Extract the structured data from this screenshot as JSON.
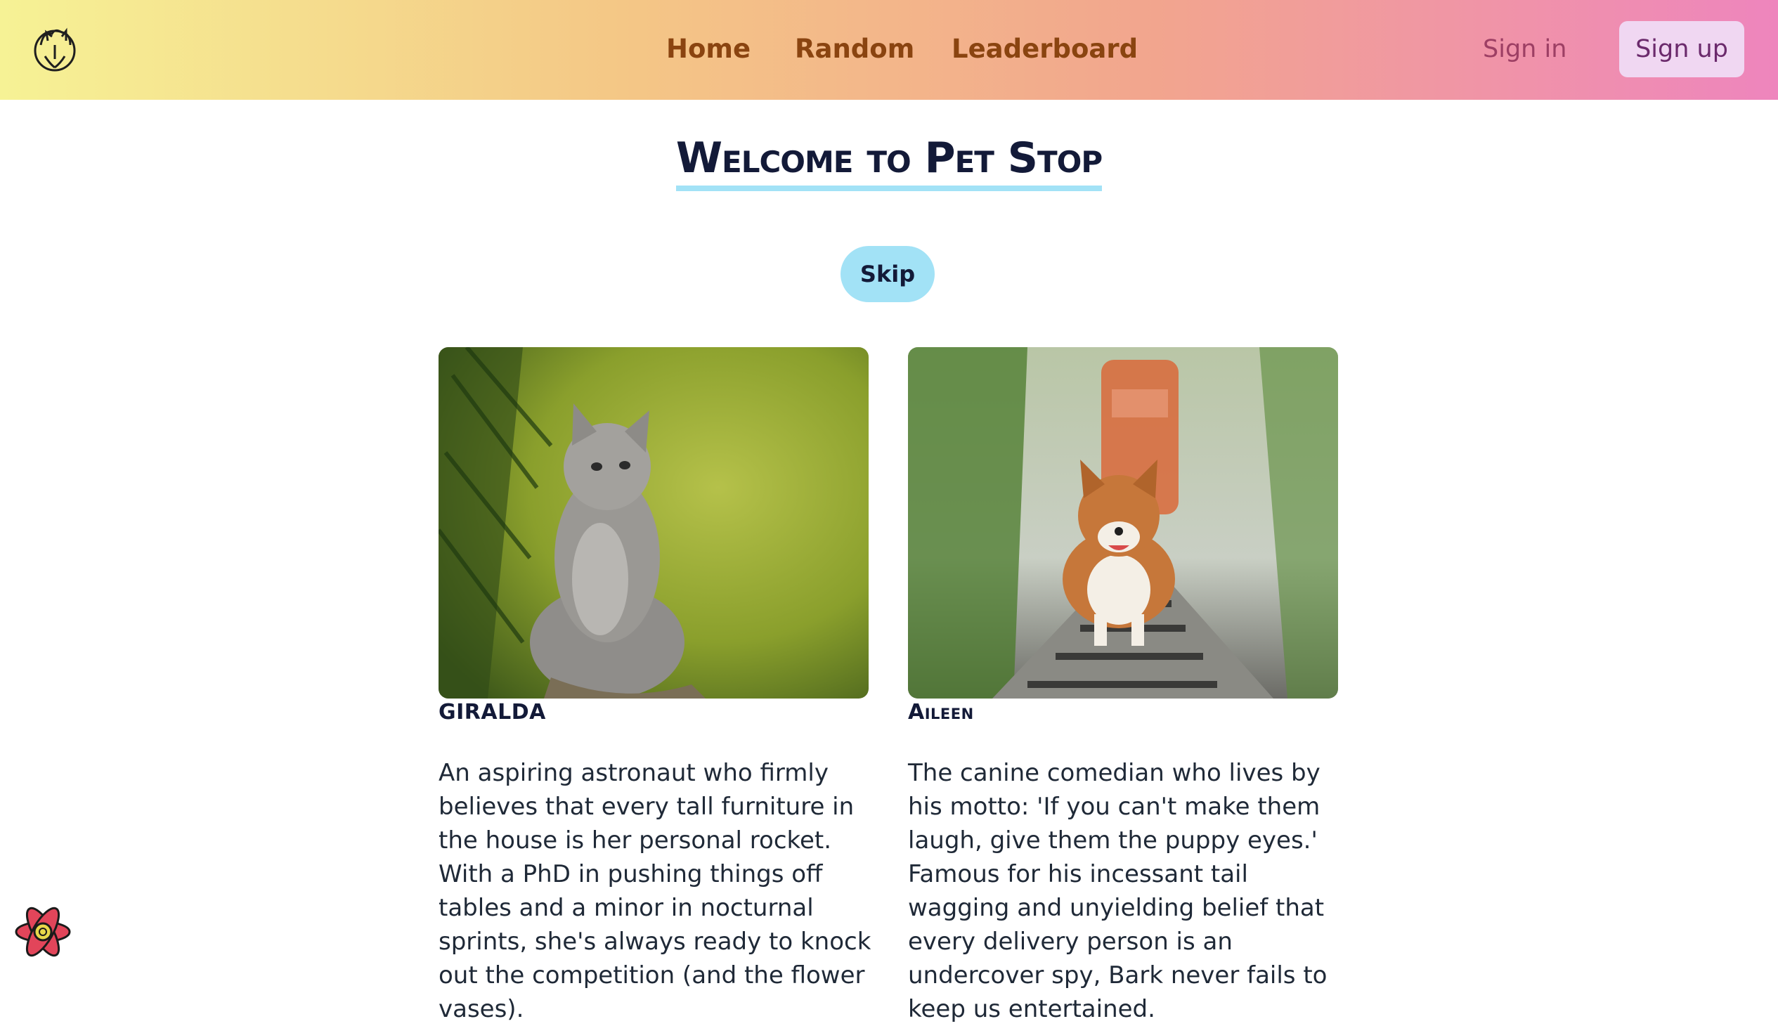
{
  "nav": {
    "links": [
      "Home",
      "Random",
      "Leaderboard"
    ],
    "sign_in": "Sign in",
    "sign_up": "Sign up",
    "logo_icon": "cat-dog-logo-icon"
  },
  "main": {
    "title": "Welcome to Pet Stop",
    "skip_label": "Skip"
  },
  "pets": [
    {
      "name": "GIRALDA",
      "image_icon": "kitten-photo",
      "description": "An aspiring astronaut who firmly believes that every tall furniture in the house is her personal rocket. With a PhD in pushing things off tables and a minor in nocturnal sprints, she's always ready to knock out the competition (and the flower vases)."
    },
    {
      "name": "Aileen",
      "image_icon": "corgi-photo",
      "description": "The canine comedian who lives by his motto: 'If you can't make them laugh, give them the puppy eyes.' Famous for his incessant tail wagging and unyielding belief that every delivery person is an undercover spy, Bark never fails to keep us entertained."
    }
  ],
  "colors": {
    "accent": "#a2e2f6",
    "title": "#131a38",
    "nav_text": "#8a4410",
    "signup_bg": "#f0d7f2"
  },
  "floating_button_icon": "flower-badge-icon"
}
